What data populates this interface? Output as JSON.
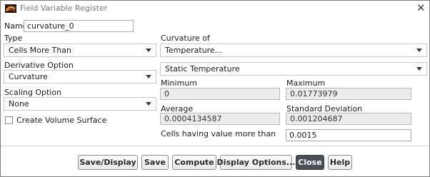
{
  "window": {
    "title": "Field Variable Register"
  },
  "name": {
    "label": "Name",
    "value": "curvature_0"
  },
  "type": {
    "label": "Type",
    "selected": "Cells More Than"
  },
  "derivative": {
    "label": "Derivative Option",
    "selected": "Curvature"
  },
  "scaling": {
    "label": "Scaling Option",
    "selected": "None"
  },
  "volume_surface": {
    "label": "Create Volume Surface",
    "checked": false
  },
  "curvature_of": {
    "label": "Curvature of",
    "selected": "Temperature...",
    "sub_selected": "Static Temperature"
  },
  "stats": {
    "minimum_label": "Minimum",
    "minimum_value": "0",
    "maximum_label": "Maximum",
    "maximum_value": "0.01773979",
    "average_label": "Average",
    "average_value": "0.0004134587",
    "stddev_label": "Standard Deviation",
    "stddev_value": "0.001204687"
  },
  "threshold": {
    "label": "Cells having value more than",
    "value": "0.0015"
  },
  "buttons": {
    "save_display": "Save/Display",
    "save": "Save",
    "compute": "Compute",
    "display_options": "Display Options...",
    "close": "Close",
    "help": "Help"
  },
  "icons": {
    "app": "fluent-app-icon",
    "close": "close-icon",
    "dropdown": "chevron-down-icon"
  }
}
